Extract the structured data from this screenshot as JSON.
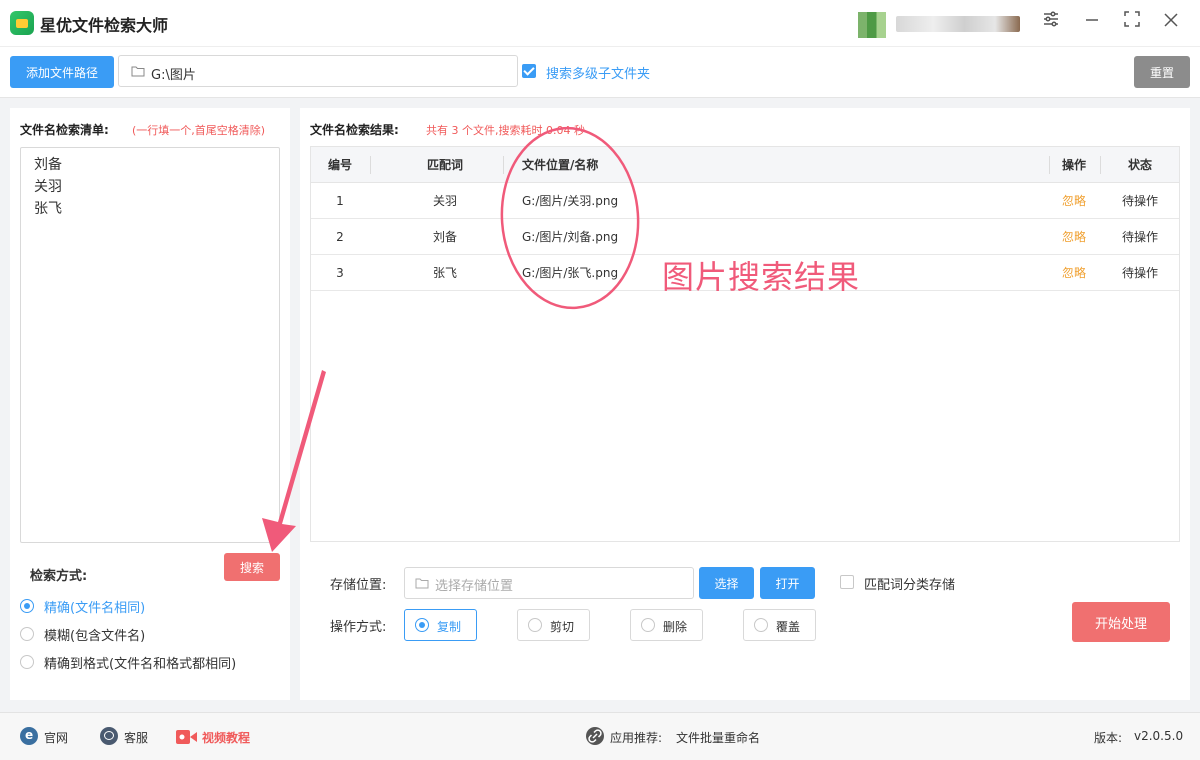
{
  "app": {
    "title": "星优文件检索大师",
    "window_controls": [
      "settings",
      "minimize",
      "maximize",
      "close"
    ]
  },
  "toolbar": {
    "add_path_label": "添加文件路径",
    "path_value": "G:\\图片",
    "subfolder_label": "搜索多级子文件夹",
    "subfolder_checked": true,
    "reset_label": "重置"
  },
  "left": {
    "list_title": "文件名检索清单:",
    "list_hint": "(一行填一个,首尾空格清除)",
    "names": [
      "刘备",
      "关羽",
      "张飞"
    ],
    "mode_label": "检索方式:",
    "search_label": "搜索",
    "modes": [
      {
        "label": "精确(文件名相同)",
        "selected": true
      },
      {
        "label": "模糊(包含文件名)",
        "selected": false
      },
      {
        "label": "精确到格式(文件名和格式都相同)",
        "selected": false
      }
    ]
  },
  "results": {
    "title": "文件名检索结果:",
    "summary": "共有 3 个文件,搜索耗时 0.04 秒",
    "columns": {
      "no": "编号",
      "keyword": "匹配词",
      "path": "文件位置/名称",
      "op": "操作",
      "status": "状态"
    },
    "rows": [
      {
        "no": "1",
        "keyword": "关羽",
        "path": "G:/图片/关羽.png",
        "op": "忽略",
        "status": "待操作"
      },
      {
        "no": "2",
        "keyword": "刘备",
        "path": "G:/图片/刘备.png",
        "op": "忽略",
        "status": "待操作"
      },
      {
        "no": "3",
        "keyword": "张飞",
        "path": "G:/图片/张飞.png",
        "op": "忽略",
        "status": "待操作"
      }
    ]
  },
  "storage": {
    "label": "存储位置:",
    "placeholder": "选择存储位置",
    "choose_label": "选择",
    "open_label": "打开",
    "classify_label": "匹配词分类存储",
    "classify_checked": false
  },
  "operation": {
    "label": "操作方式:",
    "options": [
      {
        "label": "复制",
        "selected": true
      },
      {
        "label": "剪切",
        "selected": false
      },
      {
        "label": "删除",
        "selected": false
      },
      {
        "label": "覆盖",
        "selected": false
      }
    ],
    "start_label": "开始处理"
  },
  "footer": {
    "website": "官网",
    "service": "客服",
    "video": "视频教程",
    "recommend_label": "应用推荐:",
    "recommend_app": "文件批量重命名",
    "version_label": "版本:",
    "version": "v2.0.5.0"
  },
  "annotation": {
    "text": "图片搜索结果",
    "color": "#f05a7a"
  },
  "colors": {
    "primary": "#3a9cf5",
    "danger": "#f07070",
    "warning": "#f0a030"
  }
}
